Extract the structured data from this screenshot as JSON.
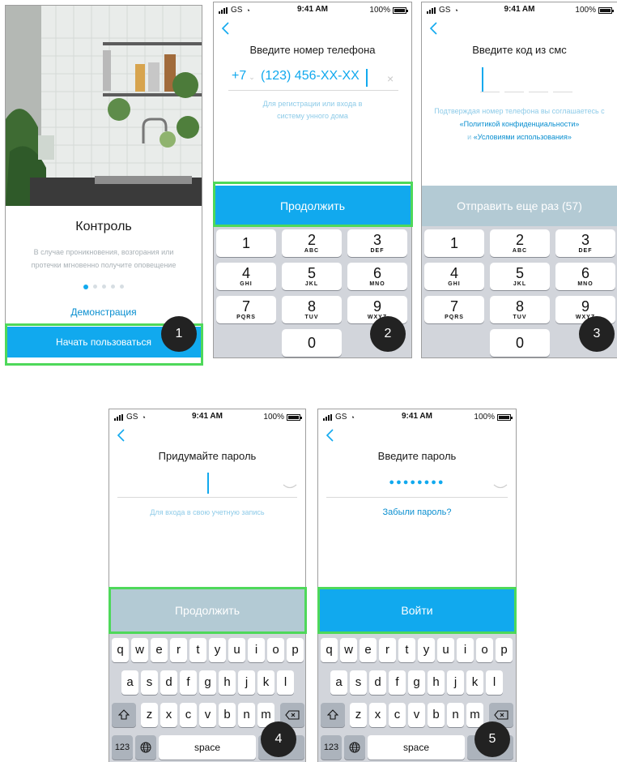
{
  "statusbar": {
    "carrier": "GS",
    "time": "9:41 AM",
    "battery": "100%"
  },
  "screen1": {
    "title": "Контроль",
    "description": "В случае проникновения, возгорания или протечки мгновенно получите оповещение",
    "page_dots": {
      "total": 5,
      "active": 1
    },
    "demo_link": "Демонстрация",
    "start_button": "Начать пользоваться",
    "step": "1"
  },
  "screen2": {
    "title": "Введите номер телефона",
    "country_code": "+7",
    "phone_value": "(123) 456-XX-XX",
    "clear_icon": "×",
    "hint": "Для регистрации или входа в систему унного дома",
    "continue_button": "Продолжить",
    "step": "2"
  },
  "screen3": {
    "title": "Введите код из смс",
    "consent_text": "Подтверждая номер телефона вы соглашаетесь с",
    "privacy_link": "«Политикой конфиденциальности»",
    "and_text": "и",
    "terms_link": "«Условиями использования»",
    "resend_button": "Отправить еще раз (57)",
    "step": "3"
  },
  "screen4": {
    "title": "Придумайте пароль",
    "hint": "Для входа в свою учетную запись",
    "continue_button": "Продолжить",
    "step": "4"
  },
  "screen5": {
    "title": "Введите пароль",
    "password_mask": "●●●●●●●●",
    "forgot_link": "Забыли пароль?",
    "login_button": "Войти",
    "step": "5"
  },
  "numpad": [
    {
      "d": "1",
      "l": ""
    },
    {
      "d": "2",
      "l": "ABC"
    },
    {
      "d": "3",
      "l": "DEF"
    },
    {
      "d": "4",
      "l": "GHI"
    },
    {
      "d": "5",
      "l": "JKL"
    },
    {
      "d": "6",
      "l": "MNO"
    },
    {
      "d": "7",
      "l": "PQRS"
    },
    {
      "d": "8",
      "l": "TUV"
    },
    {
      "d": "9",
      "l": "WXYZ"
    },
    {
      "d": "0",
      "l": ""
    }
  ],
  "keyboard": {
    "row1": [
      "q",
      "w",
      "e",
      "r",
      "t",
      "y",
      "u",
      "i",
      "o",
      "p"
    ],
    "row2": [
      "a",
      "s",
      "d",
      "f",
      "g",
      "h",
      "j",
      "k",
      "l"
    ],
    "row3": [
      "z",
      "x",
      "c",
      "v",
      "b",
      "n",
      "m"
    ],
    "num_key": "123",
    "space_key": "space"
  },
  "colors": {
    "accent": "#11a9ee",
    "highlight": "#4ed85a",
    "disabled": "#b3cad4"
  },
  "icons": {
    "back": "chevron-left-icon",
    "globe": "globe-icon",
    "shift": "shift-icon",
    "backspace": "backspace-icon",
    "eye_closed": "eye-closed-icon"
  }
}
